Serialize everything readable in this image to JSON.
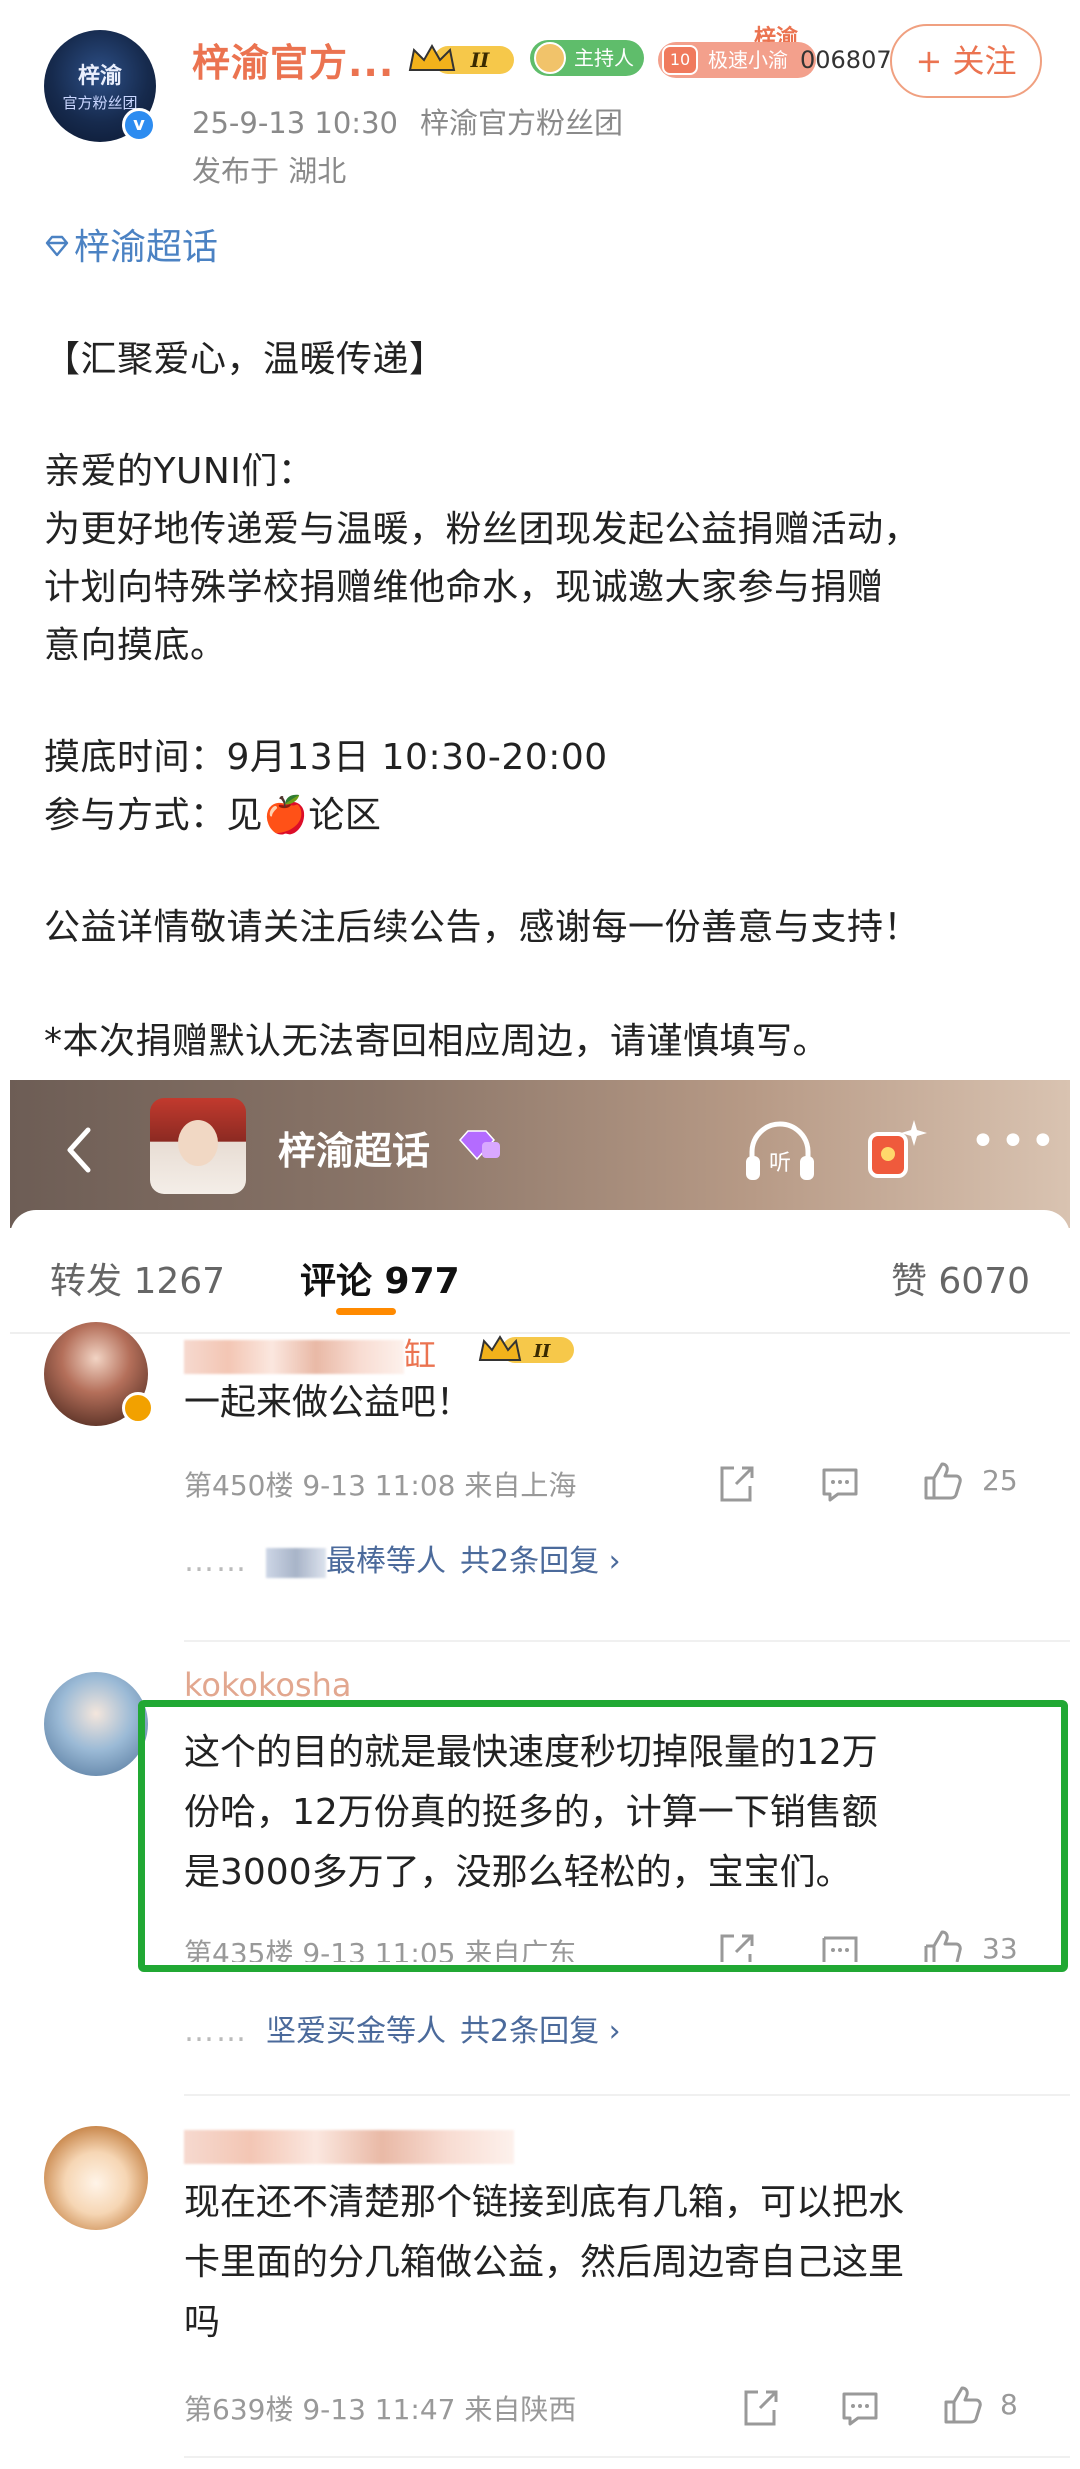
{
  "post": {
    "author": "梓渝官方...",
    "datetime": "25-9-13 10:30",
    "source": "梓渝官方粉丝团",
    "location": "发布于 湖北",
    "badges": {
      "crown_level": "II",
      "host_label": "主持人",
      "fan_top": "梓渝",
      "fan_level": "10",
      "fan_label": "极速小渝",
      "fan_number": "006807"
    },
    "follow_label": "+ 关注",
    "topic": "梓渝超话",
    "lines": [
      "【汇聚爱心，温暖传递】",
      "亲爱的YUNI们：",
      "为更好地传递爱与温暖，粉丝团现发起公益捐赠活动，",
      "计划向特殊学校捐赠维他命水，现诚邀大家参与捐赠",
      "意向摸底。",
      "摸底时间：9月13日 10:30-20:00",
      "参与方式：见🍎论区",
      "公益详情敬请关注后续公告，感谢每一份善意与支持！",
      "*本次捐赠默认无法寄回相应周边，请谨慎填写。"
    ],
    "avatar_text": [
      "梓渝",
      "官方粉丝团"
    ]
  },
  "app_bar": {
    "title": "梓渝超话",
    "listen_label": "听"
  },
  "tabs": {
    "repost": "转发 1267",
    "comment": "评论 977",
    "like": "赞 6070"
  },
  "comments": [
    {
      "name_suffix": "缸",
      "crown_level": "II",
      "text": [
        "一起来做公益吧！"
      ],
      "floor": "第450楼",
      "time": "9-13 11:08",
      "from": "来自上海",
      "likes": "25",
      "reply_who": "最棒等人",
      "reply_count": "共2条回复 ›"
    },
    {
      "name_prefix": "kokokosha",
      "text": [
        "这个的目的就是最快速度秒切掉限量的12万",
        "份哈，12万份真的挺多的，计算一下销售额",
        "是3000多万了，没那么轻松的，宝宝们。"
      ],
      "floor": "第435楼",
      "time": "9-13 11:05",
      "from": "来自广东",
      "likes": "33",
      "reply_who": "坚爱买金等人",
      "reply_count": "共2条回复 ›"
    },
    {
      "text": [
        "现在还不清楚那个链接到底有几箱，可以把水",
        "卡里面的分几箱做公益，然后周边寄自己这里",
        "吗"
      ],
      "floor": "第639楼",
      "time": "9-13 11:47",
      "from": "来自陕西",
      "likes": "8"
    }
  ],
  "reply_dots": "……",
  "colors": {
    "accent_orange": "#eb7350",
    "link_blue": "#4b82c3",
    "highlight_green": "#21a834",
    "tab_underline": "#ff8a00"
  }
}
